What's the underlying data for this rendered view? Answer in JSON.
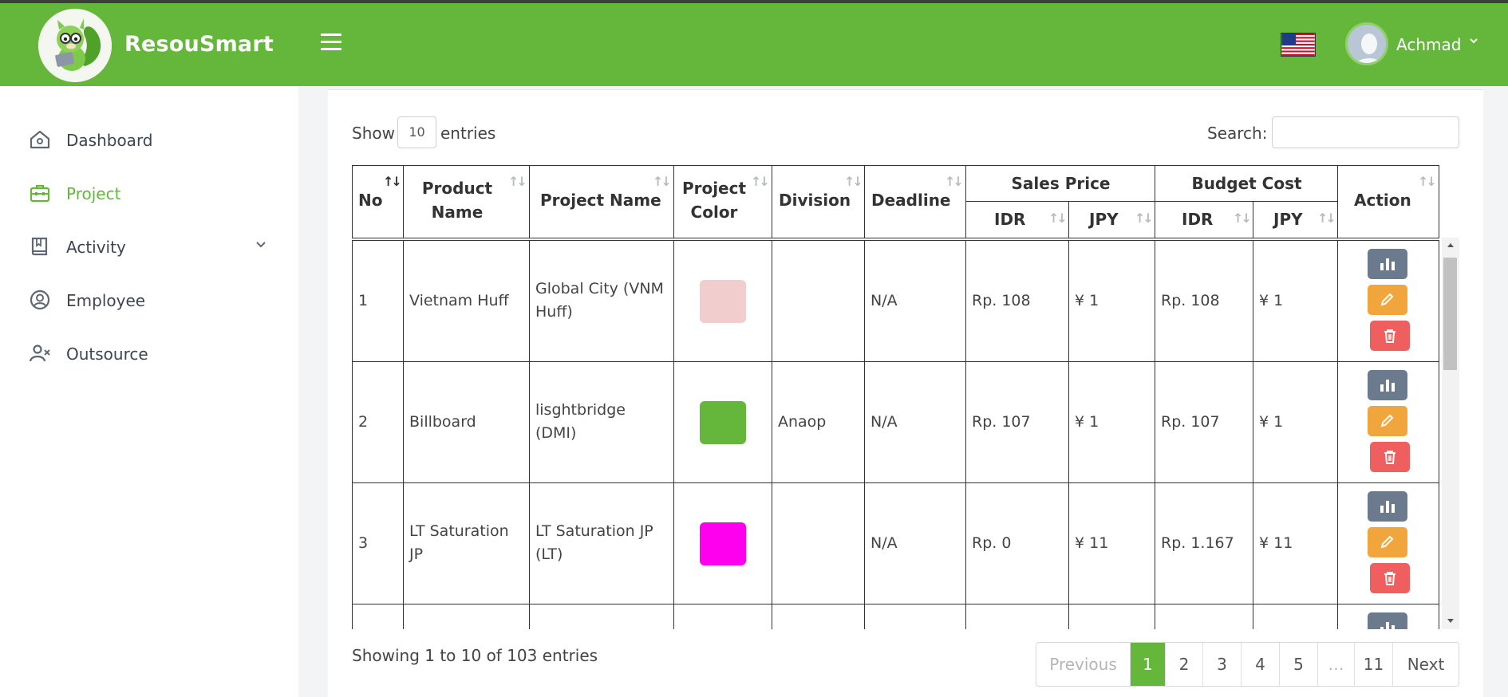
{
  "header": {
    "brand": "ResouSmart",
    "user_name": "Achmad",
    "colors": {
      "primary": "#65b73b"
    }
  },
  "sidebar": {
    "items": [
      {
        "label": "Dashboard",
        "icon": "home-icon"
      },
      {
        "label": "Project",
        "icon": "briefcase-icon",
        "active": true
      },
      {
        "label": "Activity",
        "icon": "book-icon",
        "has_submenu": true
      },
      {
        "label": "Employee",
        "icon": "user-circle-icon"
      },
      {
        "label": "Outsource",
        "icon": "user-x-icon"
      }
    ]
  },
  "table_controls": {
    "show_label": "Show",
    "entries_value": "10",
    "entries_label": "entries",
    "search_label": "Search:",
    "search_value": ""
  },
  "table": {
    "headers": {
      "no": "No",
      "product_name": "Product Name",
      "project_name": "Project Name",
      "project_color": "Project Color",
      "division": "Division",
      "deadline": "Deadline",
      "sales_price": "Sales Price",
      "budget_cost": "Budget Cost",
      "idr": "IDR",
      "jpy": "JPY",
      "action": "Action"
    },
    "rows": [
      {
        "no": "1",
        "product": "Vietnam Huff",
        "project": "Global City (VNM Huff)",
        "color": "#f2cdcd",
        "division": "",
        "deadline": "N/A",
        "sales_idr": "Rp. 108",
        "sales_jpy": "¥ 1",
        "budget_idr": "Rp. 108",
        "budget_jpy": "¥ 1"
      },
      {
        "no": "2",
        "product": "Billboard",
        "project": "lisghtbridge (DMI)",
        "color": "#65b73b",
        "division": "Anaop",
        "deadline": "N/A",
        "sales_idr": "Rp. 107",
        "sales_jpy": "¥ 1",
        "budget_idr": "Rp. 107",
        "budget_jpy": "¥ 1"
      },
      {
        "no": "3",
        "product": "LT Saturation JP",
        "project": "LT Saturation JP (LT)",
        "color": "#ff00ee",
        "division": "",
        "deadline": "N/A",
        "sales_idr": "Rp. 0",
        "sales_jpy": "¥ 11",
        "budget_idr": "Rp. 1.167",
        "budget_jpy": "¥ 11"
      }
    ]
  },
  "footer": {
    "info": "Showing 1 to 10 of 103 entries",
    "pagination": {
      "previous": "Previous",
      "pages": [
        "1",
        "2",
        "3",
        "4",
        "5",
        "…",
        "11"
      ],
      "active_page": "1",
      "next": "Next"
    }
  }
}
